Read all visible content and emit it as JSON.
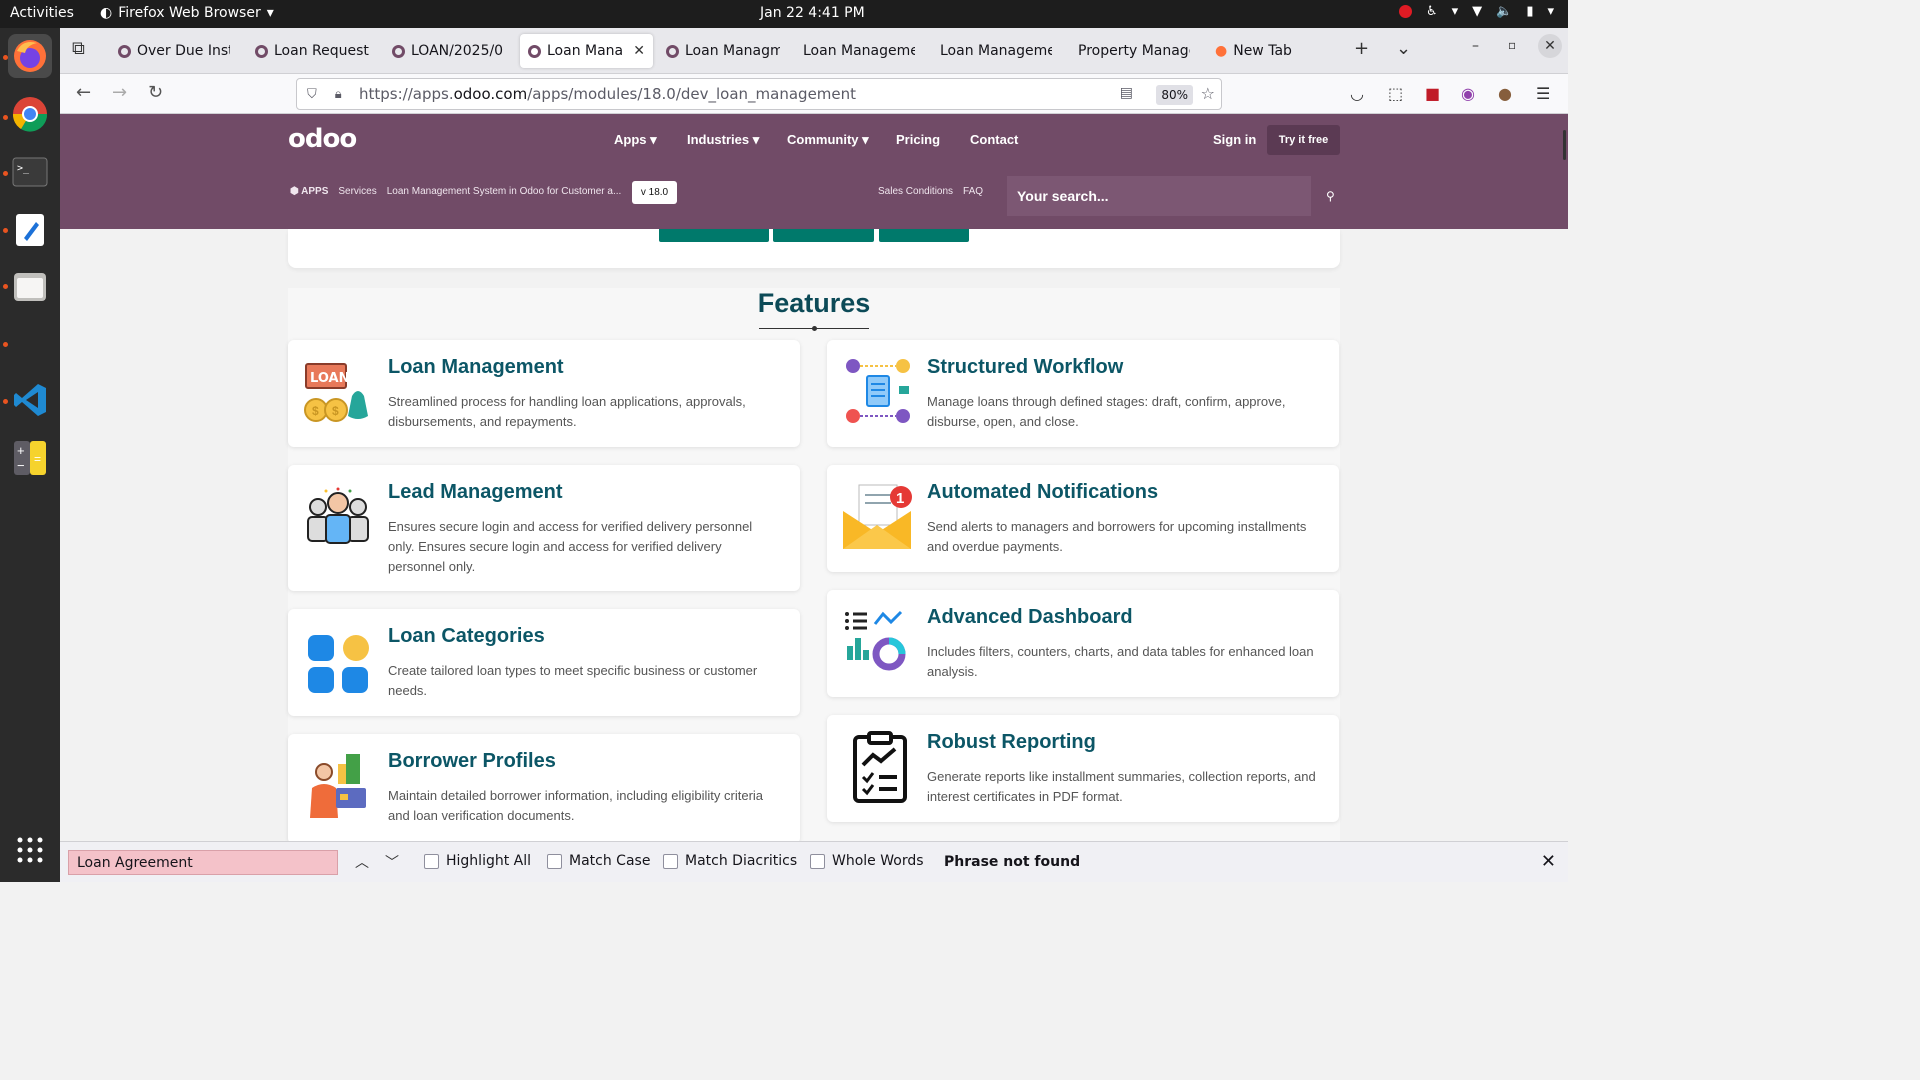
{
  "system": {
    "activities": "Activities",
    "app_name": "Firefox Web Browser",
    "clock": "Jan 22  4:41 PM"
  },
  "browser": {
    "tabs": [
      {
        "title": "Over Due Inst"
      },
      {
        "title": "Loan Request"
      },
      {
        "title": "LOAN/2025/0"
      },
      {
        "title": "Loan Manag"
      },
      {
        "title": "Loan Managm"
      },
      {
        "title": "Loan Manageme"
      },
      {
        "title": "Loan Manageme"
      },
      {
        "title": "Property Manage"
      },
      {
        "title": "New Tab"
      }
    ],
    "url_prefix": "https://apps.",
    "url_domain": "odoo.com",
    "url_path": "/apps/modules/18.0/dev_loan_management",
    "zoom": "80%"
  },
  "odoo": {
    "logo": "odoo",
    "nav": [
      "Apps",
      "Industries",
      "Community",
      "Pricing",
      "Contact"
    ],
    "sign_in": "Sign in",
    "try_free": "Try it free",
    "breadcrumb": [
      "APPS",
      "Services",
      "Loan Management System in Odoo for Customer a..."
    ],
    "version": "v 18.0",
    "sales_conditions": "Sales Conditions",
    "faq": "FAQ",
    "search_placeholder": "Your search..."
  },
  "features": {
    "title": "Features",
    "items": [
      {
        "title": "Loan Management",
        "desc": "Streamlined process for handling loan applications, approvals, disbursements, and repayments.",
        "icon": "loan-money-icon"
      },
      {
        "title": "Structured Workflow",
        "desc": "Manage loans through defined stages: draft, confirm, approve, disburse, open, and close.",
        "icon": "workflow-icon"
      },
      {
        "title": "Lead Management",
        "desc": "Ensures secure login and access for verified delivery personnel only. Ensures secure login and access for verified delivery personnel only.",
        "icon": "team-icon"
      },
      {
        "title": "Automated Notifications",
        "desc": "Send alerts to managers and borrowers for upcoming installments and overdue payments.",
        "icon": "envelope-notification-icon"
      },
      {
        "title": "Loan Categories",
        "desc": "Create tailored loan types to meet specific business or customer needs.",
        "icon": "categories-icon"
      },
      {
        "title": "Advanced Dashboard",
        "desc": "Includes filters, counters, charts, and data tables for enhanced loan analysis.",
        "icon": "dashboard-icon"
      },
      {
        "title": "Borrower Profiles",
        "desc": "Maintain detailed borrower information, including eligibility criteria and loan verification documents.",
        "icon": "borrower-icon"
      },
      {
        "title": "Robust Reporting",
        "desc": "Generate reports like installment summaries, collection reports, and interest certificates in PDF format.",
        "icon": "report-clipboard-icon"
      }
    ]
  },
  "findbar": {
    "query": "Loan  Agreement",
    "highlight_all": "Highlight All",
    "match_case": "Match Case",
    "match_diacritics": "Match Diacritics",
    "whole_words": "Whole Words",
    "status": "Phrase not found"
  }
}
